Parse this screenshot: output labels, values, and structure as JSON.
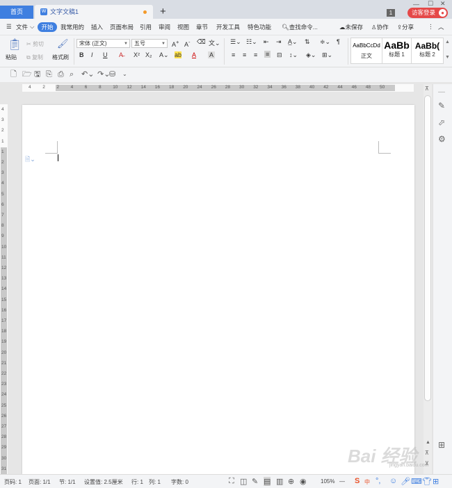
{
  "tabs": {
    "home": "首页",
    "doc": "文字文稿1",
    "new": "+"
  },
  "window": {
    "badge": "1",
    "visitor": "访客登录"
  },
  "menu": {
    "file": "文件",
    "items": [
      "开始",
      "我常用的",
      "插入",
      "页面布局",
      "引用",
      "审阅",
      "视图",
      "章节",
      "开发工具",
      "特色功能"
    ],
    "search": "查找命令...",
    "unsaved": "未保存",
    "collab": "协作",
    "share": "分享"
  },
  "ribbon": {
    "paste": "粘贴",
    "cut": "剪切",
    "copy": "复制",
    "format_painter": "格式刷",
    "font_name": "宋体 (正文)",
    "font_size": "五号",
    "bold": "B",
    "italic": "I",
    "underline": "U",
    "styles": [
      {
        "sample": "AaBbCcDd",
        "label": "正文"
      },
      {
        "sample": "AaBb",
        "label": "标题 1"
      },
      {
        "sample": "AaBb(",
        "label": "标题 2"
      }
    ]
  },
  "ruler": {
    "h_ticks": [
      "4",
      "2",
      "2",
      "4",
      "6",
      "8",
      "10",
      "12",
      "14",
      "16",
      "18",
      "20",
      "24",
      "26",
      "28",
      "30",
      "32",
      "34",
      "36",
      "38",
      "40",
      "42",
      "44",
      "46",
      "48",
      "50"
    ],
    "v_ticks": [
      "4",
      "3",
      "2",
      "1",
      "1",
      "2",
      "3",
      "4",
      "5",
      "6",
      "7",
      "8",
      "9",
      "10",
      "11",
      "12",
      "13",
      "14",
      "15",
      "16",
      "17",
      "18",
      "19",
      "20",
      "21",
      "22",
      "23",
      "24",
      "25",
      "26",
      "27",
      "28",
      "29",
      "30",
      "31"
    ]
  },
  "status": {
    "page_num": "页码: 1",
    "pages": "页面: 1/1",
    "section": "节: 1/1",
    "setting": "设置值: 2.5厘米",
    "row": "行: 1",
    "col": "列: 1",
    "words": "字数: 0",
    "zoom": "105%",
    "ime": "中"
  },
  "watermark": {
    "brand": "Bai 经验",
    "sub": "jingyan.baidu.com"
  },
  "colors": {
    "accent": "#3f7fe0",
    "visitor": "#e54848",
    "modified_dot": "#f39a2b"
  }
}
